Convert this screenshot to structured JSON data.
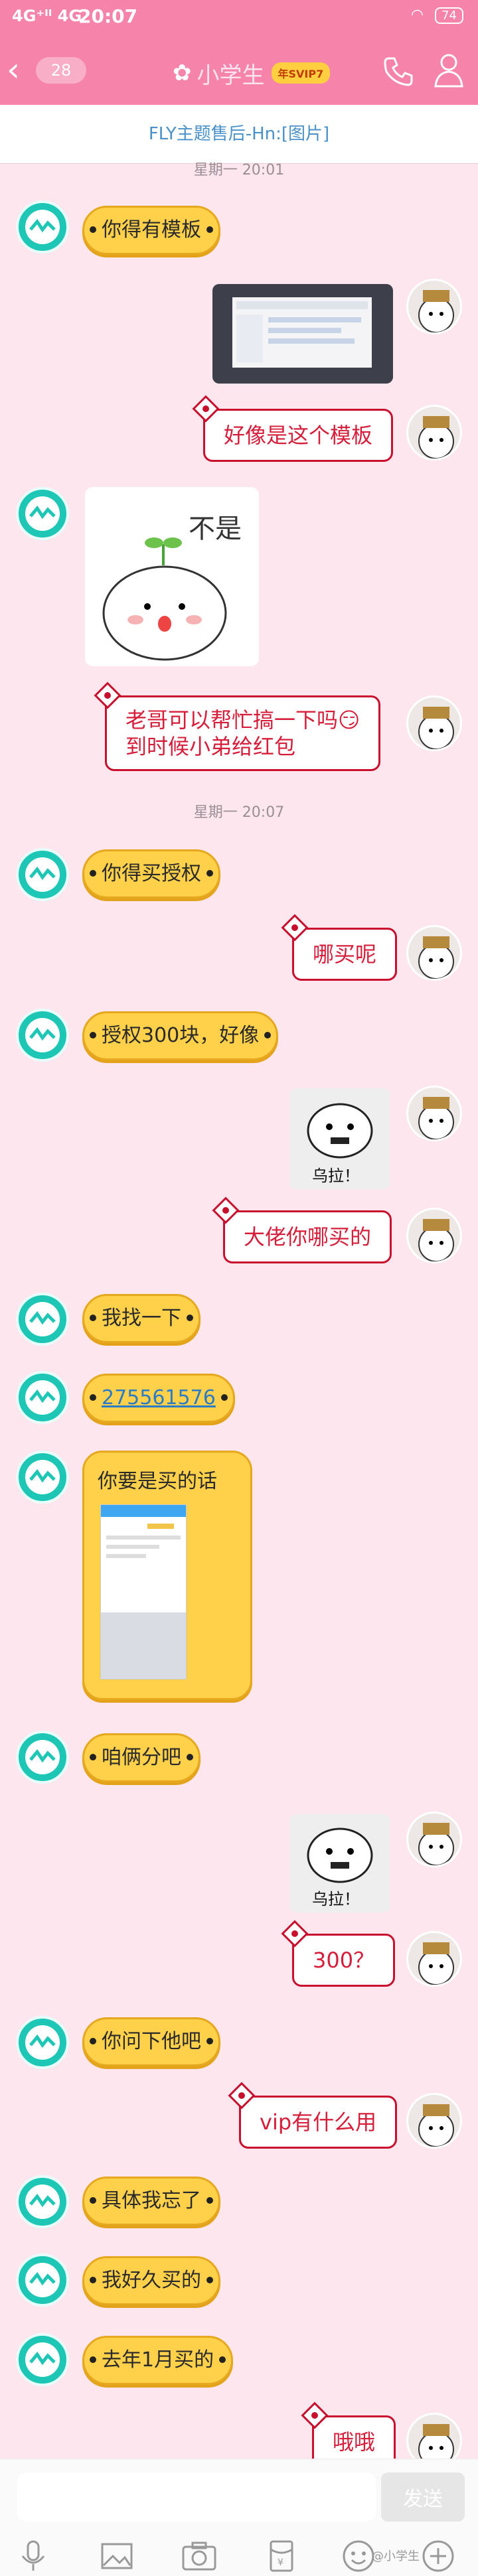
{
  "status_bar": {
    "signal_text": "4G⁺ᴵᴵ 4G",
    "time": "20:07",
    "battery": "74"
  },
  "header": {
    "back_count": "28",
    "title": "小学生",
    "svip": "年SVIP7"
  },
  "notice": {
    "text": "FLY主题售后-Hn:[图片]"
  },
  "timestamps": [
    "星期一 20:01",
    "星期一 20:07"
  ],
  "messages": [
    {
      "side": "left",
      "text": "你得有模板"
    },
    {
      "side": "right",
      "type": "image",
      "desc": "screenshot"
    },
    {
      "side": "right",
      "text": "好像是这个模板"
    },
    {
      "side": "left",
      "type": "sticker",
      "text": "不是"
    },
    {
      "side": "right",
      "text": "老哥可以帮忙搞一下吗😏",
      "text2": "到时候小弟给红包"
    },
    {
      "side": "left",
      "text": "你得买授权"
    },
    {
      "side": "right",
      "text": "哪买呢"
    },
    {
      "side": "left",
      "text": "授权300块，好像"
    },
    {
      "side": "right",
      "type": "sticker",
      "text": "乌拉！"
    },
    {
      "side": "right",
      "text": "大佬你哪买的"
    },
    {
      "side": "left",
      "text": "我找一下"
    },
    {
      "side": "left",
      "text": "275561576"
    },
    {
      "side": "left",
      "text": "你要是买的话"
    },
    {
      "side": "left",
      "text": "咱俩分吧"
    },
    {
      "side": "right",
      "type": "sticker",
      "text": "乌拉！"
    },
    {
      "side": "right",
      "text": "300？"
    },
    {
      "side": "left",
      "text": "你问下他吧"
    },
    {
      "side": "right",
      "text": "vip有什么用"
    },
    {
      "side": "left",
      "text": "具体我忘了"
    },
    {
      "side": "left",
      "text": "我好久买的"
    },
    {
      "side": "left",
      "text": "去年1月买的"
    },
    {
      "side": "right",
      "text": "哦哦"
    }
  ],
  "input": {
    "value": "",
    "send_label": "发送"
  },
  "toolbar": [
    "voice-icon",
    "image-icon",
    "camera-icon",
    "red-packet-icon",
    "emoji-icon",
    "plus-icon"
  ],
  "watermark": "@小学生"
}
